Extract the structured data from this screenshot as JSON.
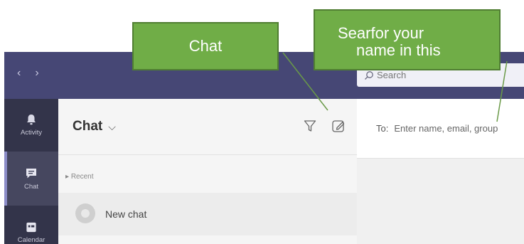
{
  "titlebar": {
    "back_arrow": "‹",
    "forward_arrow": "›",
    "search_placeholder": "Search"
  },
  "rail": {
    "items": [
      {
        "label": "Activity",
        "icon": "bell-icon"
      },
      {
        "label": "Chat",
        "icon": "chat-icon",
        "active": true
      },
      {
        "label": "Calendar",
        "icon": "calendar-icon"
      }
    ]
  },
  "chat_list": {
    "title": "Chat",
    "chevron": "⌵",
    "recent_label": "Recent",
    "new_chat_label": "New chat"
  },
  "compose": {
    "to_label": "To:",
    "to_placeholder": "Enter name, email, group"
  },
  "annotations": {
    "chat_callout": "Chat",
    "search_callout_line1": "Searfor your",
    "search_callout_line2": "name in this"
  },
  "colors": {
    "titlebar": "#464775",
    "rail": "#33344a",
    "callout_fill": "#70ad47",
    "callout_border": "#507e32"
  }
}
